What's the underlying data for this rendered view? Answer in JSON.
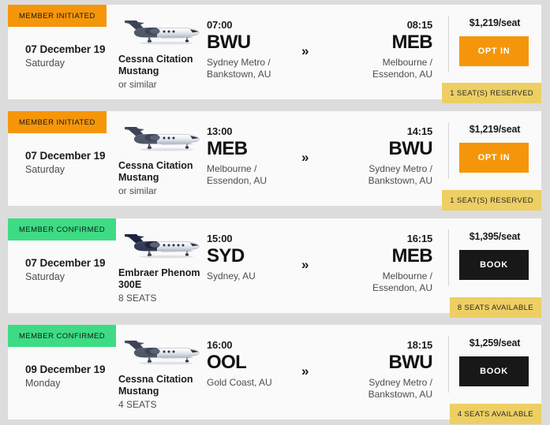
{
  "theme": {
    "page_bg": "#dcdcdc",
    "card_bg": "#fafafa",
    "orange": "#f5960a",
    "green": "#3ddc84",
    "gold_tag": "#edcf63",
    "black_button": "#181818"
  },
  "labels": {
    "arrow_icon": "»"
  },
  "flights": [
    {
      "status": "MEMBER INITIATED",
      "status_type": "initiated",
      "date": "07 December 19",
      "weekday": "Saturday",
      "aircraft_name": "Cessna Citation Mustang",
      "aircraft_sub": "or similar",
      "aircraft_type": "light-jet",
      "depart_time": "07:00",
      "depart_code": "BWU",
      "depart_place": "Sydney Metro / Bankstown, AU",
      "arrive_time": "08:15",
      "arrive_code": "MEB",
      "arrive_place": "Melbourne / Essendon, AU",
      "price": "$1,219/seat",
      "cta_label": "OPT IN",
      "cta_type": "optin",
      "seat_tag": "1 SEAT(S) RESERVED"
    },
    {
      "status": "MEMBER INITIATED",
      "status_type": "initiated",
      "date": "07 December 19",
      "weekday": "Saturday",
      "aircraft_name": "Cessna Citation Mustang",
      "aircraft_sub": "or similar",
      "aircraft_type": "light-jet",
      "depart_time": "13:00",
      "depart_code": "MEB",
      "depart_place": "Melbourne / Essendon, AU",
      "arrive_time": "14:15",
      "arrive_code": "BWU",
      "arrive_place": "Sydney Metro / Bankstown, AU",
      "price": "$1,219/seat",
      "cta_label": "OPT IN",
      "cta_type": "optin",
      "seat_tag": "1 SEAT(S) RESERVED"
    },
    {
      "status": "MEMBER CONFIRMED",
      "status_type": "confirmed",
      "date": "07 December 19",
      "weekday": "Saturday",
      "aircraft_name": "Embraer Phenom 300E",
      "aircraft_sub": "8 SEATS",
      "aircraft_type": "midsize-jet",
      "depart_time": "15:00",
      "depart_code": "SYD",
      "depart_place": "Sydney, AU",
      "arrive_time": "16:15",
      "arrive_code": "MEB",
      "arrive_place": "Melbourne / Essendon, AU",
      "price": "$1,395/seat",
      "cta_label": "BOOK",
      "cta_type": "book",
      "seat_tag": "8 SEATS AVAILABLE"
    },
    {
      "status": "MEMBER CONFIRMED",
      "status_type": "confirmed",
      "date": "09 December 19",
      "weekday": "Monday",
      "aircraft_name": "Cessna Citation Mustang",
      "aircraft_sub": "4 SEATS",
      "aircraft_type": "light-jet",
      "depart_time": "16:00",
      "depart_code": "OOL",
      "depart_place": "Gold Coast, AU",
      "arrive_time": "18:15",
      "arrive_code": "BWU",
      "arrive_place": "Sydney Metro / Bankstown, AU",
      "price": "$1,259/seat",
      "cta_label": "BOOK",
      "cta_type": "book",
      "seat_tag": "4 SEATS AVAILABLE"
    }
  ]
}
